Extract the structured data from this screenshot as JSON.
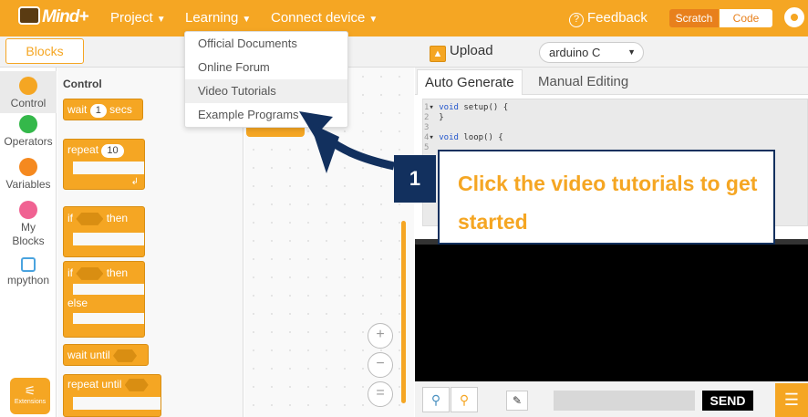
{
  "topbar": {
    "logo": "Mind+",
    "menus": [
      "Project",
      "Learning",
      "Connect device"
    ],
    "feedback": "Feedback",
    "mode_scratch": "Scratch",
    "mode_code": "Code"
  },
  "learning_menu": {
    "items": [
      "Official Documents",
      "Online Forum",
      "Video Tutorials",
      "Example Programs"
    ],
    "highlighted": "Video Tutorials"
  },
  "left_panel": {
    "tab": "Blocks",
    "categories": [
      {
        "label": "Control",
        "color": "#f5a623"
      },
      {
        "label": "Operators",
        "color": "#34b84a"
      },
      {
        "label": "Variables",
        "color": "#f5891f"
      },
      {
        "label": "My Blocks",
        "color": "#f06292"
      },
      {
        "label": "mpython",
        "color": "#4aa3df"
      }
    ],
    "extensions": "Extensions"
  },
  "palette": {
    "title": "Control",
    "wait": "wait",
    "wait_value": "1",
    "secs": "secs",
    "repeat": "repeat",
    "repeat_value": "10",
    "if": "if",
    "then": "then",
    "else": "else",
    "wait_until": "wait until",
    "repeat_until": "repeat until"
  },
  "right_panel": {
    "upload": "Upload",
    "board": "arduino C",
    "tabs": [
      "Auto Generate",
      "Manual Editing"
    ],
    "code": [
      {
        "ln": "1",
        "text": "void",
        "rest": " setup() {"
      },
      {
        "ln": "2",
        "text": "",
        "rest": "}"
      },
      {
        "ln": "3",
        "text": "",
        "rest": ""
      },
      {
        "ln": "4",
        "text": "void",
        "rest": " loop() {"
      },
      {
        "ln": "5",
        "text": "",
        "rest": ""
      }
    ],
    "send": "SEND"
  },
  "callout": {
    "number": "1",
    "text": "Click the video tutorials to get started"
  },
  "colors": {
    "accent": "#f5a623",
    "callout_navy": "#12305e"
  }
}
